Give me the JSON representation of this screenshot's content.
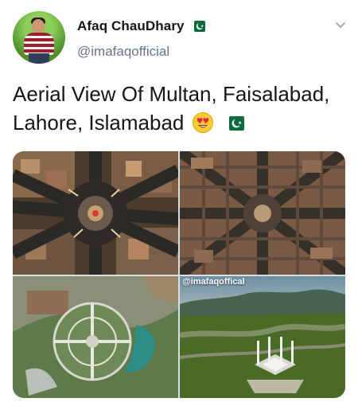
{
  "tweet": {
    "author": {
      "display_name": "Afaq ChauDhary",
      "handle": "@imafaqofficial",
      "verified_flag_icon": "pakistan-flag-icon"
    },
    "text": "Aerial View Of Multan, Faisalabad, Lahore, Islamabad",
    "emoji": [
      "heart-eyes-face-icon",
      "pakistan-flag-icon"
    ],
    "menu_icon": "chevron-down-icon",
    "media": {
      "watermark": "@imafaqoffical",
      "tiles": [
        "multan-roundabout-aerial-image",
        "faisalabad-clock-tower-grid-aerial-image",
        "lahore-park-aerial-image",
        "islamabad-faisal-mosque-aerial-image"
      ]
    }
  },
  "colors": {
    "text_primary": "#14171a",
    "text_secondary": "#657786",
    "flag_green": "#0b6b3a"
  }
}
